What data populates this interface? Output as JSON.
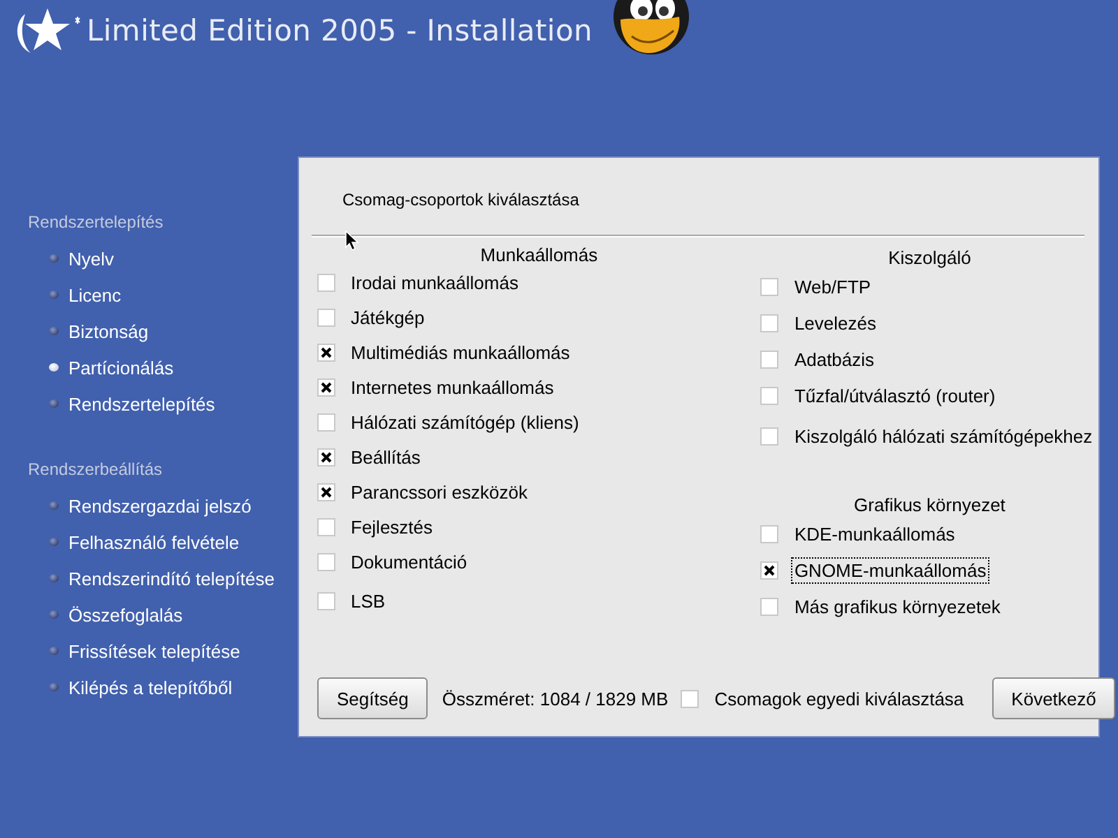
{
  "header": {
    "title": "Limited Edition 2005 - Installation"
  },
  "sidebar": {
    "sections": [
      {
        "title": "Rendszertelepítés",
        "items": [
          {
            "label": "Nyelv",
            "current": false
          },
          {
            "label": "Licenc",
            "current": false
          },
          {
            "label": "Biztonság",
            "current": false
          },
          {
            "label": "Partícionálás",
            "current": true
          },
          {
            "label": "Rendszertelepítés",
            "current": false
          }
        ]
      },
      {
        "title": "Rendszerbeállítás",
        "items": [
          {
            "label": "Rendszergazdai jelszó",
            "current": false
          },
          {
            "label": "Felhasználó felvétele",
            "current": false
          },
          {
            "label": "Rendszerindító telepítése",
            "current": false
          },
          {
            "label": "Összefoglalás",
            "current": false
          },
          {
            "label": "Frissítések telepítése",
            "current": false
          },
          {
            "label": "Kilépés a telepítőből",
            "current": false
          }
        ]
      }
    ]
  },
  "dialog": {
    "title": "Csomag-csoportok kiválasztása",
    "left_groups": [
      {
        "title": "Munkaállomás",
        "items": [
          {
            "label": "Irodai munkaállomás",
            "checked": false,
            "focused": false
          },
          {
            "label": "Játékgép",
            "checked": false,
            "focused": false
          },
          {
            "label": "Multimédiás munkaállomás",
            "checked": true,
            "focused": false
          },
          {
            "label": "Internetes munkaállomás",
            "checked": true,
            "focused": false
          },
          {
            "label": "Hálózati számítógép (kliens)",
            "checked": false,
            "focused": false
          },
          {
            "label": "Beállítás",
            "checked": true,
            "focused": false
          },
          {
            "label": "Parancssori eszközök",
            "checked": true,
            "focused": false
          },
          {
            "label": "Fejlesztés",
            "checked": false,
            "focused": false
          },
          {
            "label": "Dokumentáció",
            "checked": false,
            "focused": false
          },
          {
            "label": "LSB",
            "checked": false,
            "focused": false
          }
        ]
      }
    ],
    "right_groups": [
      {
        "title": "Kiszolgáló",
        "items": [
          {
            "label": "Web/FTP",
            "checked": false,
            "focused": false
          },
          {
            "label": "Levelezés",
            "checked": false,
            "focused": false
          },
          {
            "label": "Adatbázis",
            "checked": false,
            "focused": false
          },
          {
            "label": "Tűzfal/útválasztó (router)",
            "checked": false,
            "focused": false
          },
          {
            "label": "Kiszolgáló hálózati számítógépekhez",
            "checked": false,
            "focused": false
          }
        ]
      },
      {
        "title": "Grafikus környezet",
        "items": [
          {
            "label": "KDE-munkaállomás",
            "checked": false,
            "focused": false
          },
          {
            "label": "GNOME-munkaállomás",
            "checked": true,
            "focused": true
          },
          {
            "label": "Más grafikus környezetek",
            "checked": false,
            "focused": false
          }
        ]
      }
    ],
    "help_button": "Segítség",
    "total_size": "Összméret: 1084 / 1829 MB",
    "individual": {
      "label": "Csomagok egyedi kiválasztása",
      "checked": false
    },
    "next_button": "Következő"
  }
}
